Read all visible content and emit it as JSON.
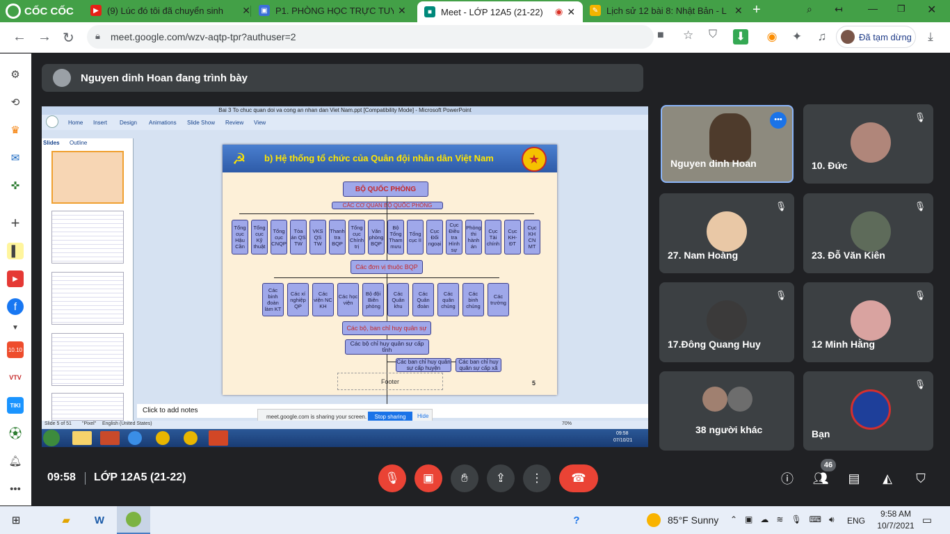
{
  "browser": {
    "brand": "CỐC CỐC",
    "tabs": [
      {
        "title": "(9) Lúc đó tôi đã chuyển sinh",
        "icon": "youtube-icon"
      },
      {
        "title": "P1. PHÒNG HỌC TRỰC TUYẾ",
        "icon": "user-badge-icon"
      },
      {
        "title": "Meet - LỚP 12A5 (21-22)",
        "icon": "meet-icon"
      },
      {
        "title": "Lịch sử 12 bài 8: Nhật Bản - L",
        "icon": "lesson-icon"
      }
    ],
    "url": "meet.google.com/wzv-aqtp-tpr?authuser=2",
    "paused_label": "Đã tạm dừng"
  },
  "meet": {
    "presenting": "Nguyen dinh Hoan đang trình bày",
    "time": "09:58",
    "meeting_name": "LỚP 12A5 (21-22)",
    "participant_count": "46",
    "tiles": [
      {
        "name": "Nguyen dinh Hoan"
      },
      {
        "name": "10. Đức"
      },
      {
        "name": "27. Nam Hoàng"
      },
      {
        "name": "23. Đỗ Văn Kiên"
      },
      {
        "name": "17.Đông Quang Huy"
      },
      {
        "name": "12 Minh Hằng"
      },
      {
        "name": "38 người khác"
      },
      {
        "name": "Bạn"
      }
    ]
  },
  "ppt": {
    "window_title": "Bai 3 To chuc quan doi va cong an nhan dan Viet Nam.ppt [Compatibility Mode] - Microsoft PowerPoint",
    "tabs": [
      "Home",
      "Insert",
      "Design",
      "Animations",
      "Slide Show",
      "Review",
      "View"
    ],
    "pane_tabs": [
      "Slides",
      "Outline"
    ],
    "notes": "Click to add notes",
    "status_left": "Slide 5 of 51",
    "status_theme": "\"Pixel\"",
    "status_lang": "English (United States)",
    "zoom": "70%",
    "sharing_text": "meet.google.com is sharing your screen.",
    "stop_sharing": "Stop sharing",
    "hide": "Hide",
    "clock": "09:58",
    "date": "07/10/21"
  },
  "slide": {
    "title": "b) Hệ thống tổ chức của Quân đội nhân dân Việt Nam",
    "top": "BỘ QUỐC PHÒNG",
    "agencies": "CÁC CƠ QUAN BỘ QUỐC PHÒNG",
    "row1": [
      "Tổng cục Hậu Cần",
      "Tổng cục Kỹ thuật",
      "Tổng cục CNQP",
      "Tòa án QS TW",
      "VKS QS TW",
      "Thanh tra BQP",
      "Tổng cục Chính trị",
      "Văn phòng BQP",
      "Bộ Tổng Tham mưu",
      "Tổng cục II",
      "Cục Đối ngoại",
      "Cục Điều tra Hình sự",
      "Phòng thi hành án",
      "Cục Tài chính",
      "Cục KH-ĐT",
      "Cục KH CN MT"
    ],
    "units": "Các đơn vị thuộc BQP",
    "row2": [
      "Các binh đoàn làm KT",
      "Các xí nghiệp QP",
      "Các viện NC KH",
      "Các học viện",
      "Bộ đội Biên phòng",
      "Các Quân khu",
      "Các Quân đoàn",
      "Các quân chủng",
      "Các binh chủng",
      "Các trường"
    ],
    "command": "Các bộ, ban chỉ huy quân sự",
    "province": "Các bộ chỉ huy quân sự cấp tỉnh",
    "district": "Các ban chỉ huy quân sự cấp huyện",
    "commune": "Các ban chỉ huy quân sự cấp xã",
    "footer": "Footer",
    "page": "5"
  },
  "taskbar": {
    "weather": "85°F  Sunny",
    "lang": "ENG",
    "time": "9:58 AM",
    "date": "10/7/2021"
  }
}
